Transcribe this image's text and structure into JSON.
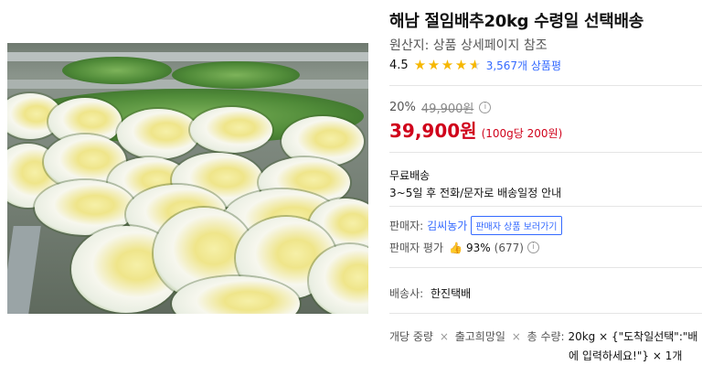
{
  "product": {
    "title": "해남 절임배추20kg 수령일 선택배송",
    "origin": "원산지: 상품 상세페이지 참조",
    "rating_score": "4.5",
    "review_count": "3,567개 상품평"
  },
  "price": {
    "discount_rate": "20%",
    "original_price": "49,900원",
    "info_icon": "ⓘ",
    "sale_price": "39,900원",
    "unit_price": "(100g당 200원)"
  },
  "shipping": {
    "title": "무료배송",
    "description": "3~5일 후 전화/문자로 배송일정 안내"
  },
  "seller": {
    "label": "판매자:",
    "name": "김씨농가",
    "link_label": "판매자 상품 보러가기",
    "rating_label": "판매자 평가",
    "rating_value": "93%",
    "rating_count": "(677)"
  },
  "carrier": {
    "label": "배송사:",
    "name": "한진택배"
  },
  "option": {
    "key1": "개당 중량",
    "sep": "×",
    "key2": "출고희망일",
    "key3": "총 수량:",
    "value_line1": "20kg × {\"도착일선택\":\"배",
    "value_line2": "에 입력하세요!\"} × 1개"
  },
  "icons": {
    "star": "star-icon",
    "thumb": "thumbs-up-icon",
    "info": "info-icon"
  },
  "colors": {
    "accent_blue": "#346aff",
    "price_red": "#d0021b",
    "star_yellow": "#f6b700"
  }
}
